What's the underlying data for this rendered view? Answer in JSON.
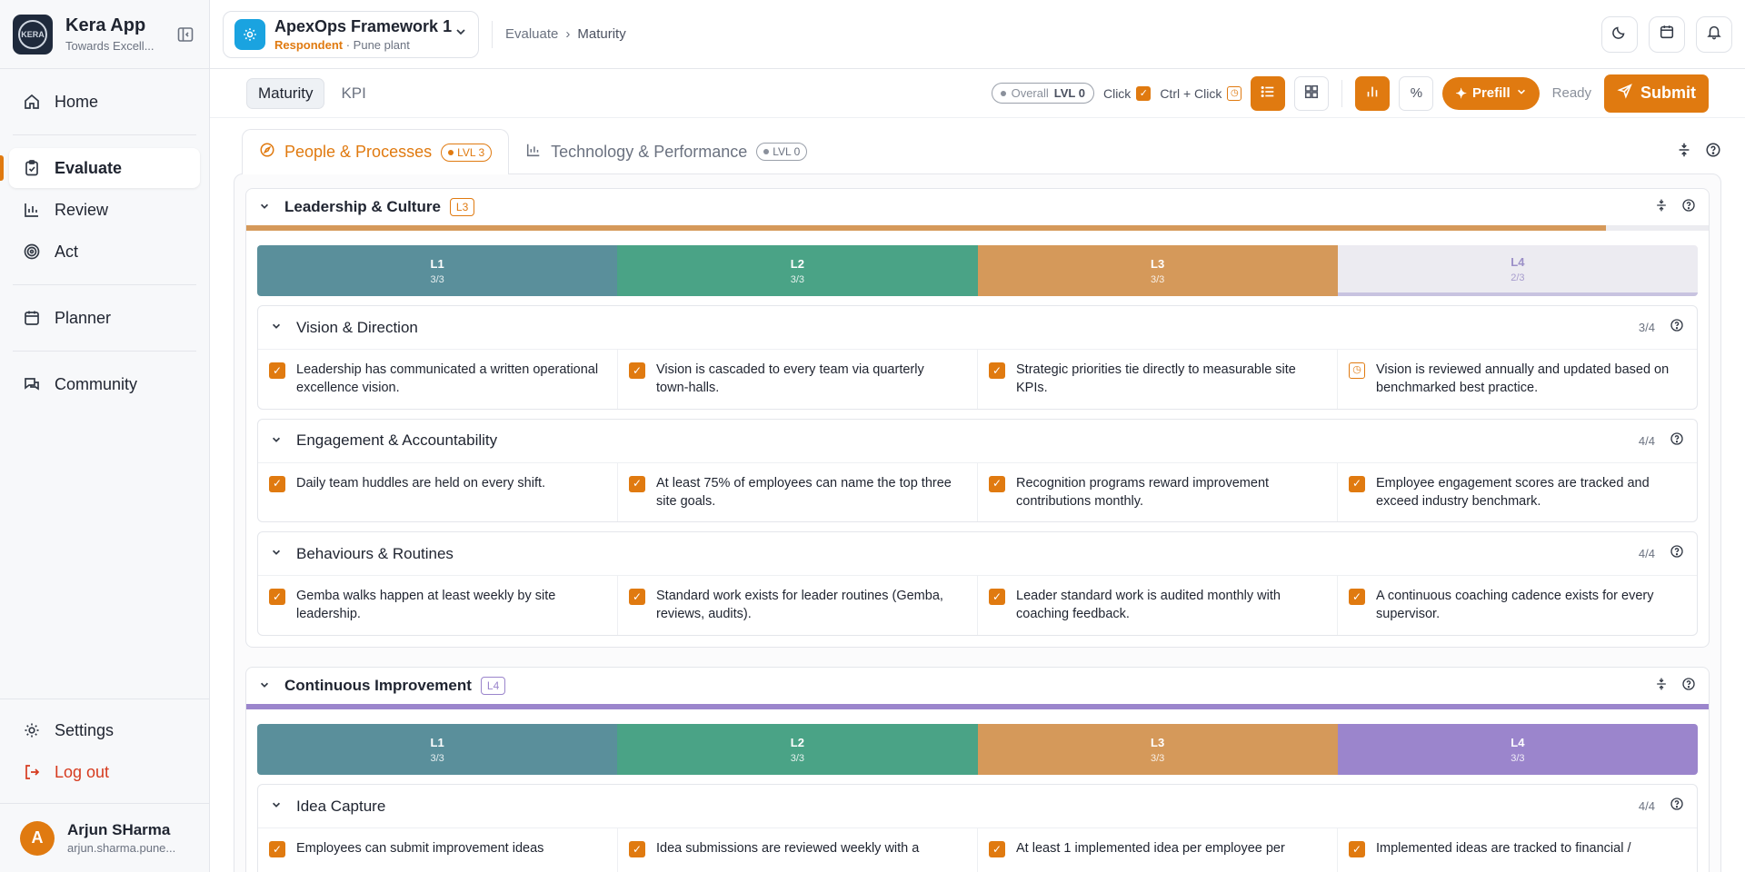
{
  "app": {
    "name": "Kera App",
    "tagline": "Towards Excell...",
    "logo_text": "KERA"
  },
  "sidebar": {
    "items": [
      {
        "label": "Home",
        "icon": "home-icon"
      },
      {
        "label": "Evaluate",
        "icon": "clipboard-icon",
        "active": true
      },
      {
        "label": "Review",
        "icon": "bar-chart-icon"
      },
      {
        "label": "Act",
        "icon": "target-icon"
      },
      {
        "label": "Planner",
        "icon": "calendar-icon"
      },
      {
        "label": "Community",
        "icon": "chat-icon"
      }
    ],
    "settings_label": "Settings",
    "logout_label": "Log out"
  },
  "user": {
    "initial": "A",
    "name": "Arjun SHarma",
    "email": "arjun.sharma.pune..."
  },
  "header": {
    "framework_name": "ApexOps Framework 1",
    "role": "Respondent",
    "site": " · Pune plant",
    "breadcrumb": [
      "Evaluate",
      "Maturity"
    ]
  },
  "toolbar": {
    "view_tabs": [
      "Maturity",
      "KPI"
    ],
    "overall_label": "Overall",
    "overall_level": "LVL 0",
    "click_label": "Click",
    "ctrl_click_label": "Ctrl + Click",
    "percent_label": "%",
    "prefill_label": "Prefill",
    "status": "Ready",
    "submit_label": "Submit"
  },
  "dimension_tabs": [
    {
      "label": "People & Processes",
      "level": "LVL 3",
      "active": true
    },
    {
      "label": "Technology & Performance",
      "level": "LVL 0",
      "active": false
    }
  ],
  "colors": {
    "accent": "#e07a10",
    "l1": "#5a8f9b",
    "l2": "#4aa386",
    "l3": "#d5995a",
    "l4": "#9b85cc"
  },
  "sections": [
    {
      "title": "Leadership & Culture",
      "level": "L3",
      "progress": 0.93,
      "levels": [
        {
          "name": "L1",
          "count": "3/3"
        },
        {
          "name": "L2",
          "count": "3/3"
        },
        {
          "name": "L3",
          "count": "3/3"
        },
        {
          "name": "L4",
          "count": "2/3"
        }
      ],
      "criteria": [
        {
          "title": "Vision & Direction",
          "count": "3/4",
          "items": [
            "Leadership has communicated a written operational excellence vision.",
            "Vision is cascaded to every team via quarterly town‑halls.",
            "Strategic priorities tie directly to measurable site KPIs.",
            "Vision is reviewed annually and updated based on benchmarked best practice."
          ]
        },
        {
          "title": "Engagement & Accountability",
          "count": "4/4",
          "items": [
            "Daily team huddles are held on every shift.",
            "At least 75% of employees can name the top three site goals.",
            "Recognition programs reward improvement contributions monthly.",
            "Employee engagement scores are tracked and exceed industry benchmark."
          ]
        },
        {
          "title": "Behaviours & Routines",
          "count": "4/4",
          "items": [
            "Gemba walks happen at least weekly by site leadership.",
            "Standard work exists for leader routines (Gemba, reviews, audits).",
            "Leader standard work is audited monthly with coaching feedback.",
            "A continuous coaching cadence exists for every supervisor."
          ]
        }
      ]
    },
    {
      "title": "Continuous Improvement",
      "level": "L4",
      "progress": 1.0,
      "levels": [
        {
          "name": "L1",
          "count": "3/3"
        },
        {
          "name": "L2",
          "count": "3/3"
        },
        {
          "name": "L3",
          "count": "3/3"
        },
        {
          "name": "L4",
          "count": "3/3"
        }
      ],
      "criteria": [
        {
          "title": "Idea Capture",
          "count": "4/4",
          "items": [
            "Employees can submit improvement ideas",
            "Idea submissions are reviewed weekly with a",
            "At least 1 implemented idea per employee per",
            "Implemented ideas are tracked to financial /"
          ]
        }
      ]
    }
  ]
}
